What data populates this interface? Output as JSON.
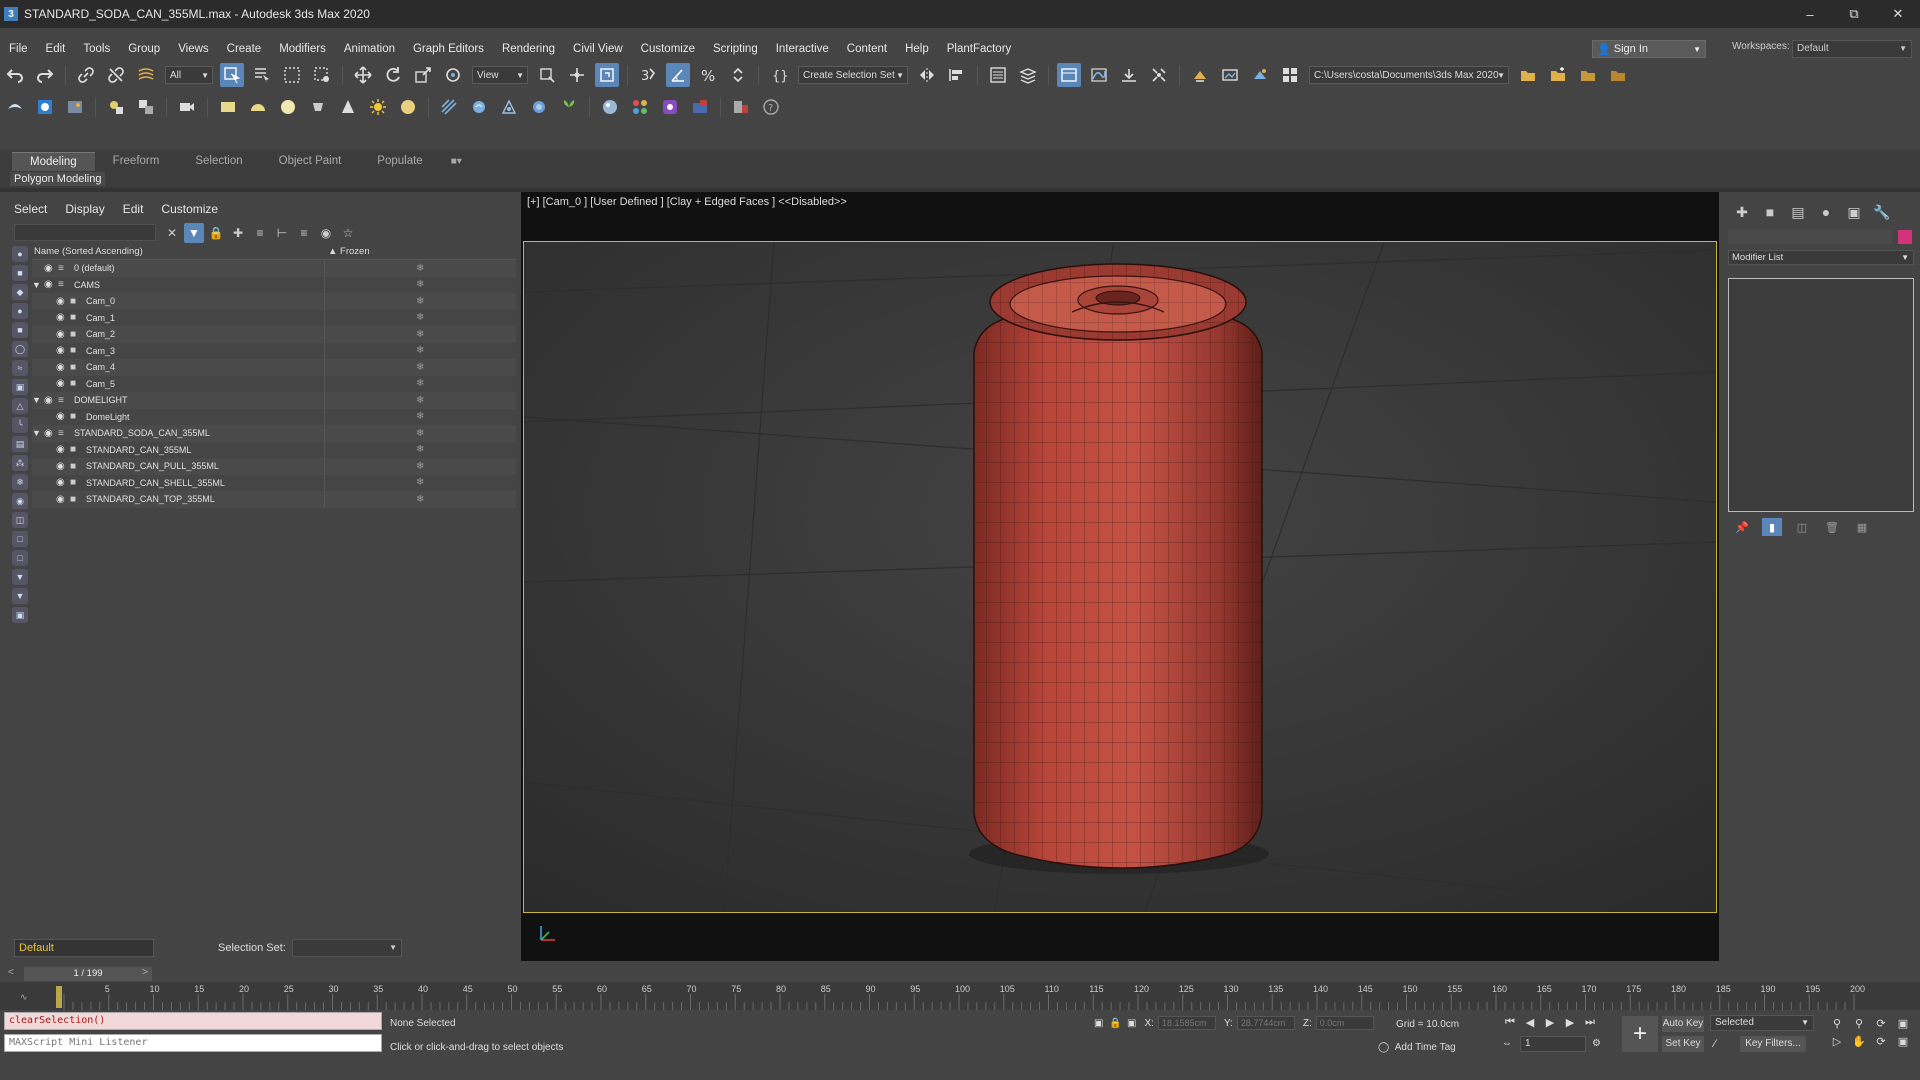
{
  "window": {
    "title": "STANDARD_SODA_CAN_355ML.max - Autodesk 3ds Max 2020",
    "app_icon_glyph": "3",
    "controls": [
      "–",
      "⧉",
      "✕"
    ]
  },
  "menu": [
    "File",
    "Edit",
    "Tools",
    "Group",
    "Views",
    "Create",
    "Modifiers",
    "Animation",
    "Graph Editors",
    "Rendering",
    "Civil View",
    "Customize",
    "Scripting",
    "Interactive",
    "Content",
    "Help",
    "PlantFactory"
  ],
  "account": {
    "sign_in": "Sign In",
    "workspaces_label": "Workspaces:",
    "workspace_value": "Default"
  },
  "toolbar": {
    "selection_filter": "All",
    "ref_coord": "View",
    "selection_set": "Create Selection Set",
    "project_path": "C:\\Users\\costa\\Documents\\3ds Max 2020"
  },
  "ribbon": {
    "tabs": [
      "Modeling",
      "Freeform",
      "Selection",
      "Object Paint",
      "Populate"
    ],
    "active_tab": "Modeling",
    "sub_tab": "Polygon Modeling"
  },
  "explorer": {
    "menu": [
      "Select",
      "Display",
      "Edit",
      "Customize"
    ],
    "col_name": "Name (Sorted Ascending)",
    "col_frozen": "▲ Frozen",
    "rows": [
      {
        "label": "0 (default)",
        "indent": 0,
        "expanded": "none"
      },
      {
        "label": "CAMS",
        "indent": 0,
        "expanded": "open"
      },
      {
        "label": "Cam_0",
        "indent": 1,
        "expanded": "none"
      },
      {
        "label": "Cam_1",
        "indent": 1,
        "expanded": "none"
      },
      {
        "label": "Cam_2",
        "indent": 1,
        "expanded": "none"
      },
      {
        "label": "Cam_3",
        "indent": 1,
        "expanded": "none"
      },
      {
        "label": "Cam_4",
        "indent": 1,
        "expanded": "none"
      },
      {
        "label": "Cam_5",
        "indent": 1,
        "expanded": "none"
      },
      {
        "label": "DOMELIGHT",
        "indent": 0,
        "expanded": "open"
      },
      {
        "label": "DomeLight",
        "indent": 1,
        "expanded": "none"
      },
      {
        "label": "STANDARD_SODA_CAN_355ML",
        "indent": 0,
        "expanded": "open"
      },
      {
        "label": "STANDARD_CAN_355ML",
        "indent": 1,
        "expanded": "none"
      },
      {
        "label": "STANDARD_CAN_PULL_355ML",
        "indent": 1,
        "expanded": "none"
      },
      {
        "label": "STANDARD_CAN_SHELL_355ML",
        "indent": 1,
        "expanded": "none"
      },
      {
        "label": "STANDARD_CAN_TOP_355ML",
        "indent": 1,
        "expanded": "none"
      }
    ],
    "layer": "Default",
    "selection_set_label": "Selection Set:"
  },
  "viewport": {
    "label": "[+] [Cam_0 ] [User Defined ] [Clay + Edged Faces ]  <<Disabled>>",
    "border_color": "#c8b63a",
    "object_color": "#b8453a"
  },
  "command_panel": {
    "modifier_list": "Modifier List",
    "object_color": "#d4337a"
  },
  "timeline": {
    "frame_display": "1 / 199",
    "ticks": [
      5,
      10,
      15,
      20,
      25,
      30,
      35,
      40,
      45,
      50,
      55,
      60,
      65,
      70,
      75,
      80,
      85,
      90,
      95,
      100,
      105,
      110,
      115,
      120,
      125,
      130,
      135,
      140,
      145,
      150,
      155,
      160,
      165,
      170,
      175,
      180,
      185,
      190,
      195,
      200
    ]
  },
  "status": {
    "script_line": "clearSelection()",
    "listener": "MAXScript Mini Listener",
    "selection": "None Selected",
    "prompt": "Click or click-and-drag to select objects",
    "x_label": "X:",
    "x_value": "18.1585cm",
    "y_label": "Y:",
    "y_value": "28.7744cm",
    "z_label": "Z:",
    "z_value": "0.0cm",
    "grid": "Grid = 10.0cm",
    "add_time_tag": "Add Time Tag",
    "frame": "1",
    "auto_key": "Auto Key",
    "set_key": "Set Key",
    "key_selected": "Selected",
    "key_filters": "Key Filters..."
  }
}
